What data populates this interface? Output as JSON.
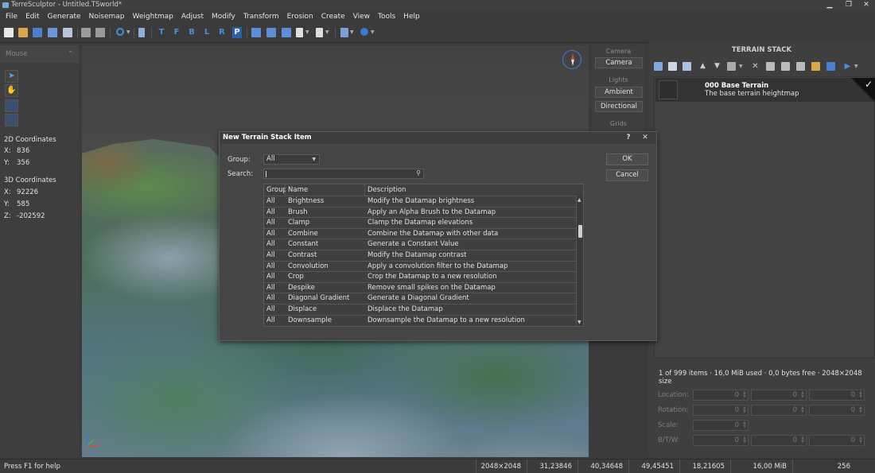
{
  "window": {
    "title": "TerreSculptor - Untitled.TSworld*",
    "minimize": "▁",
    "restore": "❐",
    "close": "✕"
  },
  "menu": [
    "File",
    "Edit",
    "Generate",
    "Noisemap",
    "Weightmap",
    "Adjust",
    "Modify",
    "Transform",
    "Erosion",
    "Create",
    "View",
    "Tools",
    "Help"
  ],
  "toolbar": {
    "letters": [
      "T",
      "F",
      "B",
      "L",
      "R",
      "P"
    ]
  },
  "left_panel": {
    "title": "Mouse",
    "collapse_icon": "⌃",
    "coords2d": {
      "label": "2D Coordinates",
      "x_label": "X:",
      "x": "836",
      "y_label": "Y:",
      "y": "356"
    },
    "coords3d": {
      "label": "3D Coordinates",
      "x_label": "X:",
      "x": "92226",
      "y_label": "Y:",
      "y": "585",
      "z_label": "Z:",
      "z": "-202592"
    }
  },
  "side_panel": {
    "camera_head": "Camera",
    "camera_btn": "Camera",
    "lights_head": "Lights",
    "ambient_btn": "Ambient",
    "directional_btn": "Directional",
    "grids_head": "Grids"
  },
  "stack": {
    "title": "TERRAIN STACK",
    "item": {
      "name": "000 Base Terrain",
      "desc": "The base terrain heightmap"
    },
    "status": "1 of 999 items · 16,0 MiB used · 0,0 bytes free · 2048×2048 size",
    "fields": {
      "location": "Location:",
      "rotation": "Rotation:",
      "scale": "Scale:",
      "btw": "B/T/W:",
      "value": "0"
    }
  },
  "statusbar": {
    "help": "Press F1 for help",
    "cells": [
      "2048×2048",
      "31,23846",
      "40,34648",
      "49,45451",
      "18,21605",
      "16,00 MiB",
      "256"
    ]
  },
  "dialog": {
    "title": "New Terrain Stack Item",
    "help": "?",
    "close": "✕",
    "group_label": "Group:",
    "group_value": "All",
    "search_label": "Search:",
    "search_value": "",
    "ok": "OK",
    "cancel": "Cancel",
    "columns": [
      "Group",
      "Name",
      "Description"
    ],
    "rows": [
      {
        "group": "All",
        "name": "Brightness",
        "desc": "Modify the Datamap brightness"
      },
      {
        "group": "All",
        "name": "Brush",
        "desc": "Apply an Alpha Brush to the Datamap"
      },
      {
        "group": "All",
        "name": "Clamp",
        "desc": "Clamp the Datamap elevations"
      },
      {
        "group": "All",
        "name": "Combine",
        "desc": "Combine the Datamap with other data"
      },
      {
        "group": "All",
        "name": "Constant",
        "desc": "Generate a Constant Value"
      },
      {
        "group": "All",
        "name": "Contrast",
        "desc": "Modify the Datamap contrast"
      },
      {
        "group": "All",
        "name": "Convolution",
        "desc": "Apply a convolution filter to the Datamap"
      },
      {
        "group": "All",
        "name": "Crop",
        "desc": "Crop the Datamap to a new resolution"
      },
      {
        "group": "All",
        "name": "Despike",
        "desc": "Remove small spikes on the Datamap"
      },
      {
        "group": "All",
        "name": "Diagonal Gradient",
        "desc": "Generate a Diagonal Gradient"
      },
      {
        "group": "All",
        "name": "Displace",
        "desc": "Displace the Datamap"
      },
      {
        "group": "All",
        "name": "Downsample",
        "desc": "Downsample the Datamap to a new resolution"
      }
    ]
  },
  "icons": {
    "new": "new-file-icon",
    "open": "open-folder-icon",
    "save": "save-icon",
    "compass": "compass-icon",
    "axis": "axis-gizmo-icon",
    "search": "search-icon"
  }
}
